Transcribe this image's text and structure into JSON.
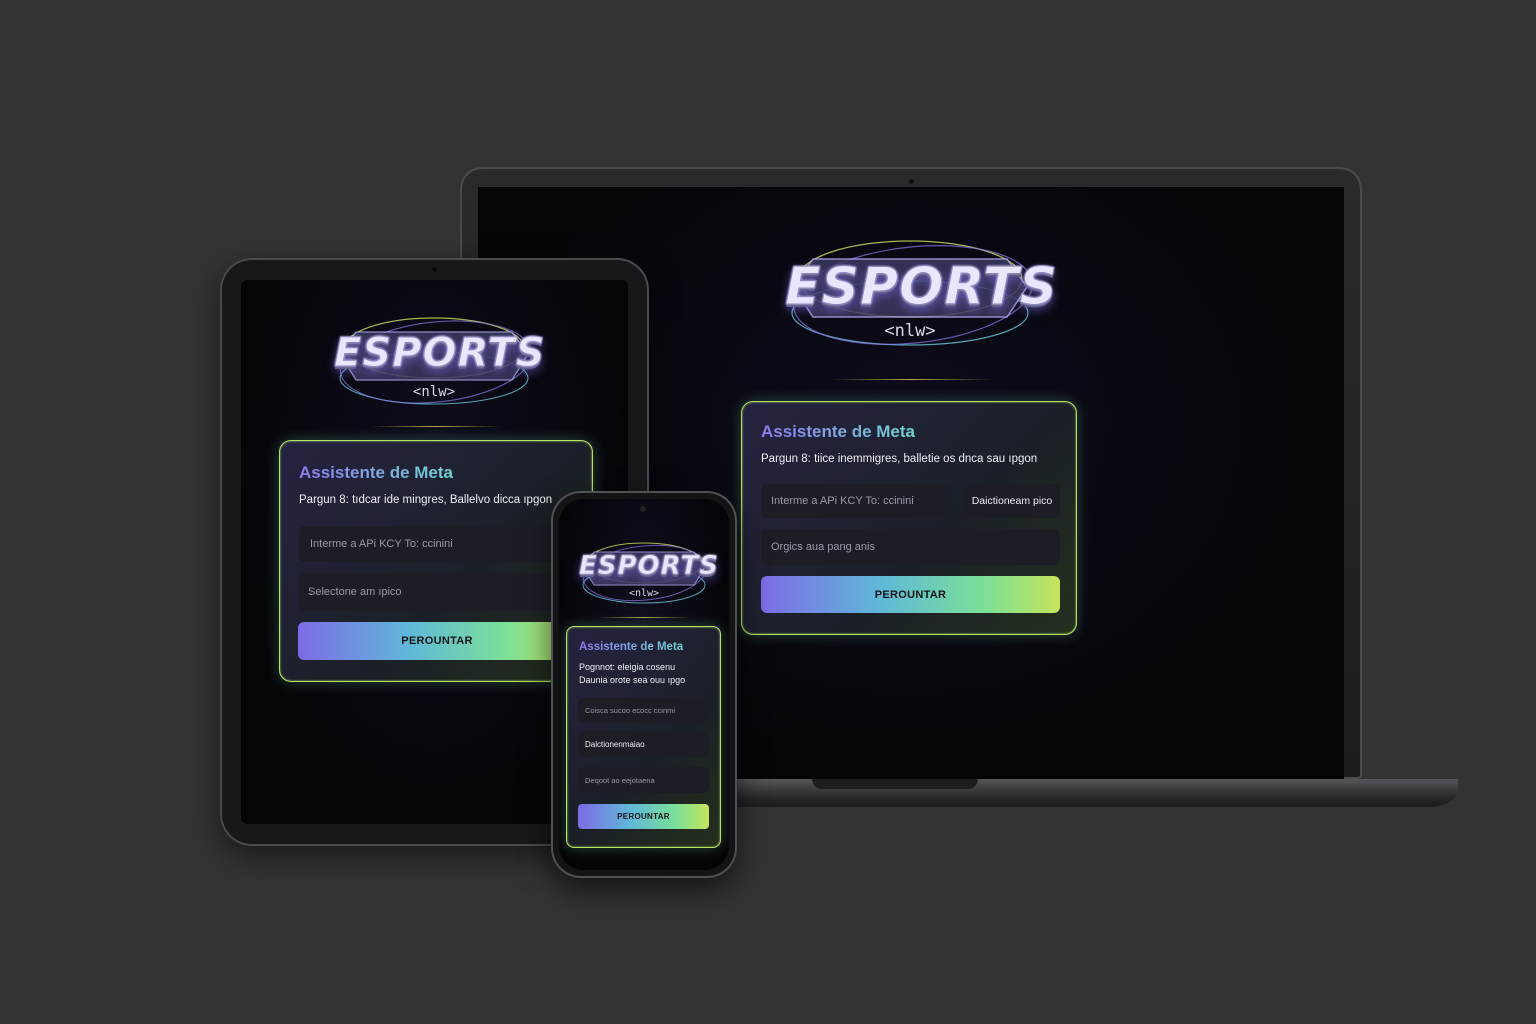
{
  "brand": {
    "wordmark": "ESPORTS",
    "tag": "<nlw>"
  },
  "colors": {
    "accent_purple": "#7d6be6",
    "accent_cyan": "#5fb8d8",
    "accent_lime": "#c6e45a",
    "background": "#333333"
  },
  "desktop": {
    "title": "Assistente de Meta",
    "subtitle": "Pargun 8: tiice inemmigres, balletie os dnca sau ıpgon",
    "api_key_placeholder": "Interme a APi KCY To: ccinini",
    "game_select": "Daictioneam pico",
    "question_placeholder": "Orgics aua pang anis",
    "submit": "PEROUNTAR"
  },
  "tablet": {
    "title": "Assistente de Meta",
    "subtitle": "Pargun 8: tıdcar ide mingres, Ballelvo dicca ıpgon",
    "api_key_placeholder": "Interme a APi KCY To: ccinini",
    "game_select": "Selectone am ıpico",
    "submit": "PEROUNTAR"
  },
  "phone": {
    "title": "Assistente de Meta",
    "subtitle_line1": "Pognnot: eleigia cosenu",
    "subtitle_line2": "Daunia orote sea ouu ıpgo",
    "api_key_placeholder": "Coisca sucoo ecocc ccinmi",
    "game_select": "Dalctionenmaiao",
    "question_placeholder": "Deqoot ao eejotaena",
    "submit": "PEROUNTAR"
  }
}
